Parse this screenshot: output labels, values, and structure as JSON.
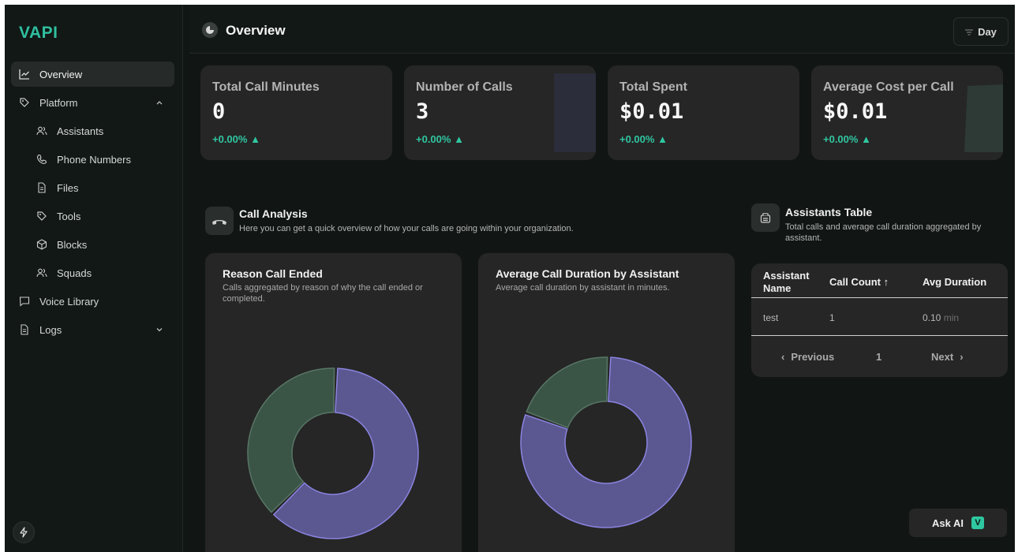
{
  "app": {
    "logo": "VAPI"
  },
  "sidebar": {
    "items": [
      {
        "label": "Overview",
        "icon": "chart-line-icon",
        "active": true
      },
      {
        "label": "Platform",
        "icon": "tag-icon",
        "expanded": true
      },
      {
        "label": "Assistants",
        "icon": "users-icon",
        "sub": true
      },
      {
        "label": "Phone Numbers",
        "icon": "phone-icon",
        "sub": true
      },
      {
        "label": "Files",
        "icon": "file-icon",
        "sub": true
      },
      {
        "label": "Tools",
        "icon": "tag-icon",
        "sub": true
      },
      {
        "label": "Blocks",
        "icon": "cube-icon",
        "sub": true
      },
      {
        "label": "Squads",
        "icon": "users-icon",
        "sub": true
      },
      {
        "label": "Voice Library",
        "icon": "message-icon"
      },
      {
        "label": "Logs",
        "icon": "file-icon",
        "collapsed": true
      }
    ]
  },
  "header": {
    "title": "Overview",
    "range_label": "Day"
  },
  "stats": [
    {
      "label": "Total Call Minutes",
      "value": "0",
      "delta": "+0.00% ▲"
    },
    {
      "label": "Number of Calls",
      "value": "3",
      "delta": "+0.00% ▲"
    },
    {
      "label": "Total Spent",
      "value": "$0.01",
      "delta": "+0.00% ▲"
    },
    {
      "label": "Average Cost per Call",
      "value": "$0.01",
      "delta": "+0.00% ▲"
    }
  ],
  "call_analysis": {
    "title": "Call Analysis",
    "subtitle": "Here you can get a quick overview of how your calls are going within your organization."
  },
  "assistants_table": {
    "title": "Assistants Table",
    "subtitle": "Total calls and average call duration aggregated by assistant.",
    "columns": [
      "Assistant Name",
      "Call Count ↑",
      "Avg Duration"
    ],
    "rows": [
      {
        "name": "test",
        "count": "1",
        "duration": "0.10",
        "unit": "min"
      }
    ],
    "pager": {
      "prev": "Previous",
      "page": "1",
      "next": "Next"
    }
  },
  "chart_data": [
    {
      "type": "pie",
      "title": "Reason Call Ended",
      "subtitle": "Calls aggregated by reason of why the call ended or completed.",
      "values": [
        62,
        38
      ],
      "colors": [
        "#5b5790",
        "#3a5446"
      ]
    },
    {
      "type": "pie",
      "title": "Average Call Duration by Assistant",
      "subtitle": "Average call duration by assistant in minutes.",
      "values": [
        80,
        20
      ],
      "colors": [
        "#5b5790",
        "#3a5446"
      ]
    }
  ],
  "ask_ai": {
    "label": "Ask AI",
    "badge": "V"
  },
  "colors": {
    "accent": "#2fc7a1",
    "purple": "#5b5790",
    "green": "#3a5446"
  }
}
